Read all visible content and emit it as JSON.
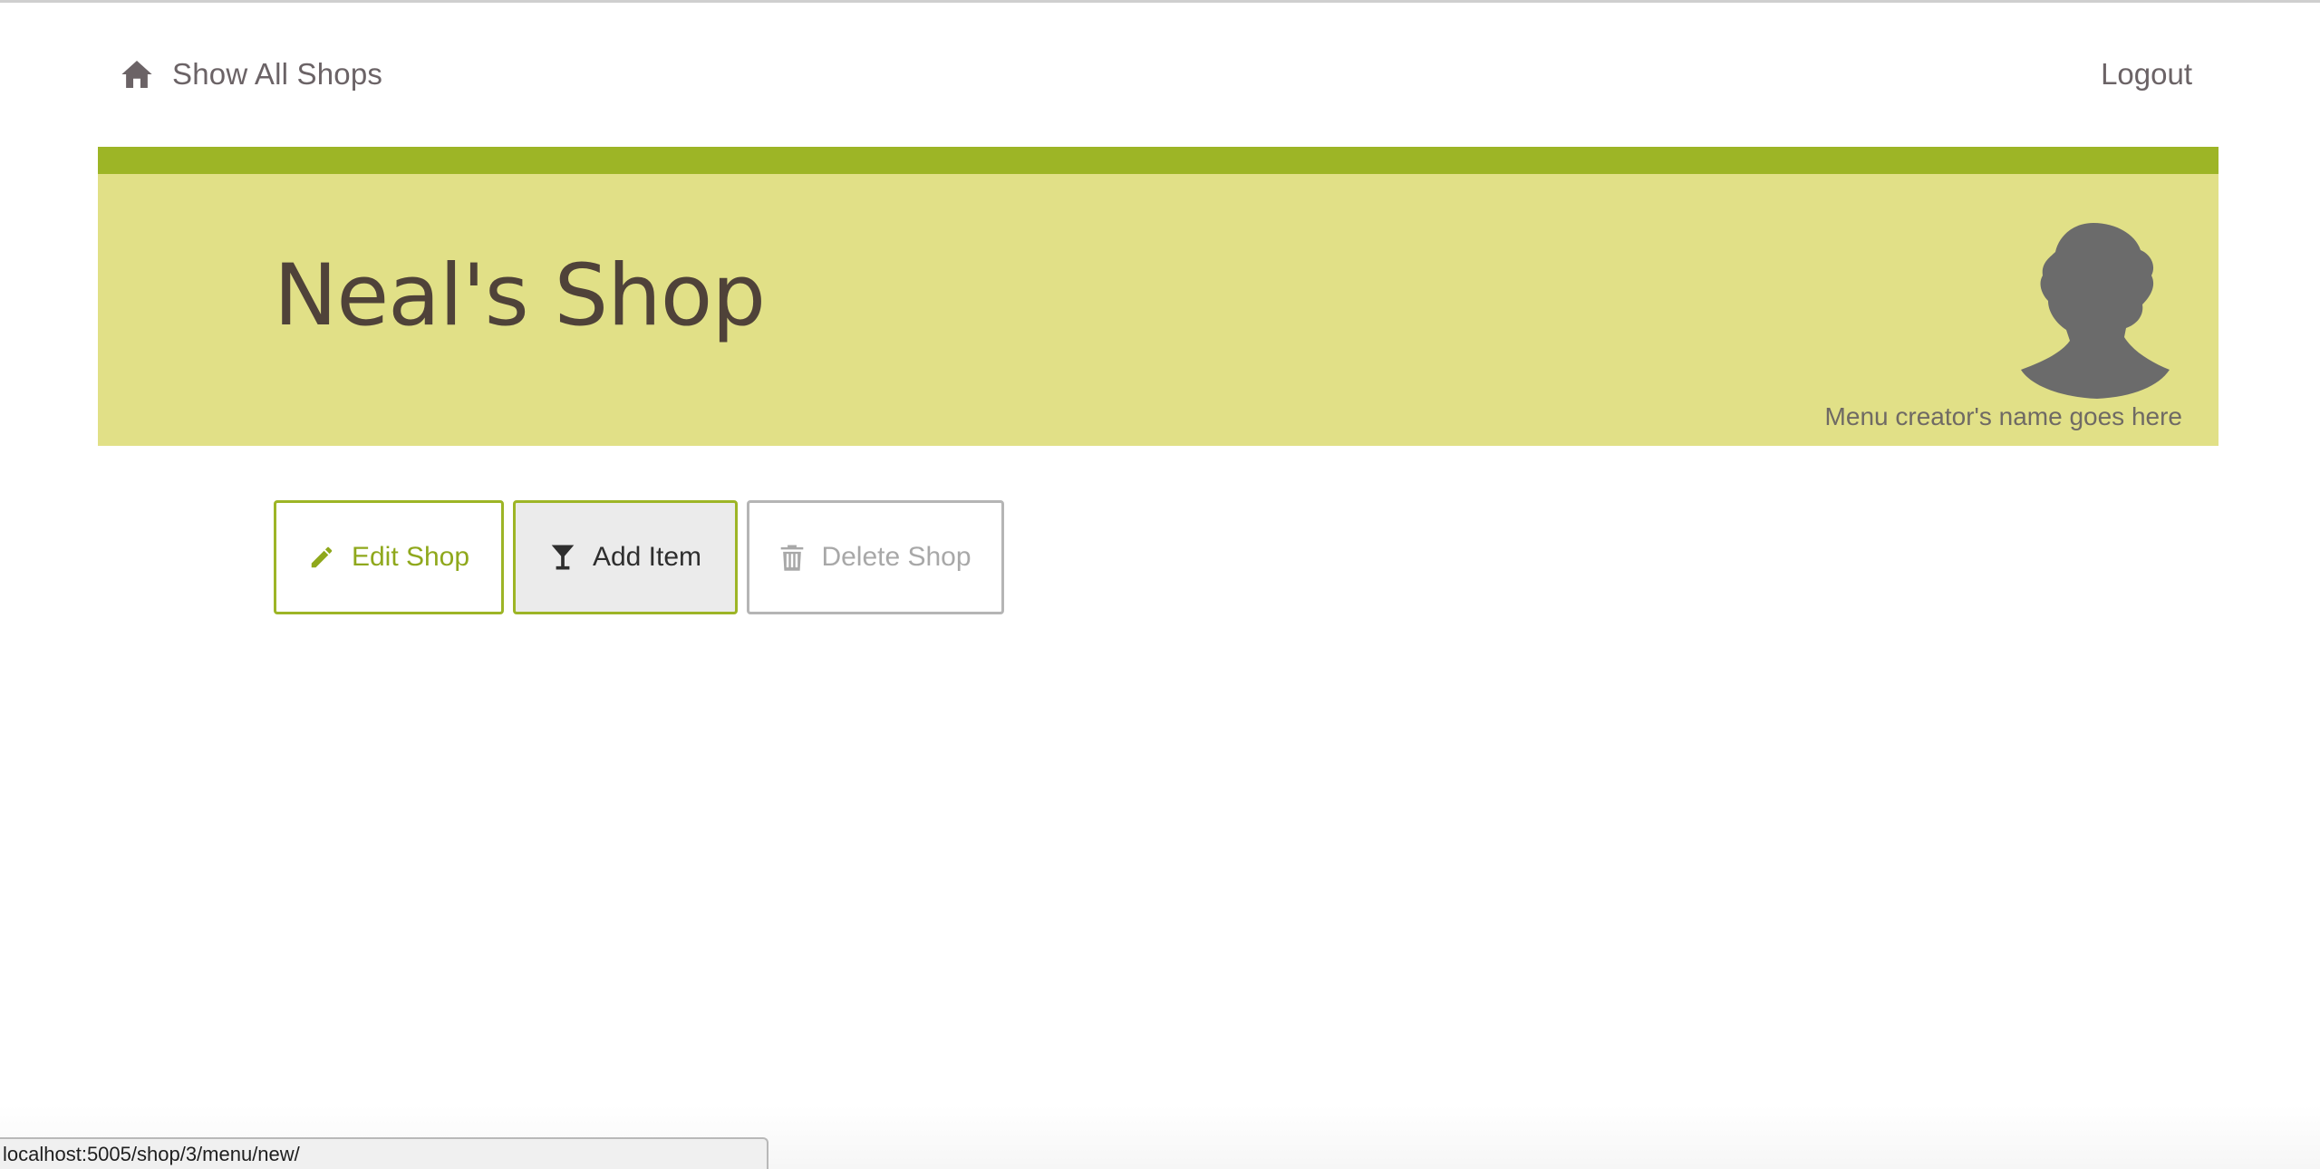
{
  "nav": {
    "home_label": "Show All Shops",
    "home_icon": "home-icon",
    "logout_label": "Logout"
  },
  "banner": {
    "title": "Neal's Shop",
    "creator_text": "Menu creator's name goes here",
    "avatar_icon": "person-silhouette-icon"
  },
  "actions": {
    "edit_label": "Edit Shop",
    "edit_icon": "pencil-icon",
    "add_label": "Add Item",
    "add_icon": "cocktail-glass-icon",
    "delete_label": "Delete Shop",
    "delete_icon": "trash-icon"
  },
  "status_bar": {
    "url": "localhost:5005/shop/3/menu/new/"
  },
  "colors": {
    "accent": "#9db526",
    "banner_bg": "#e1e087",
    "title_text": "#4f4239",
    "nav_text": "#6b6366"
  }
}
